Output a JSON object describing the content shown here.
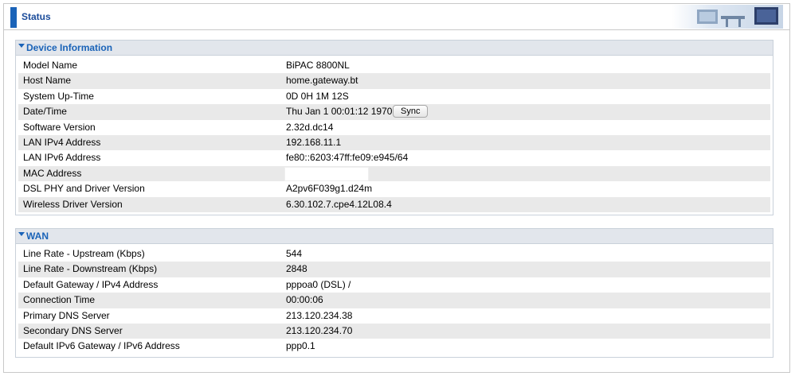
{
  "status": {
    "title": "Status"
  },
  "device": {
    "title": "Device Information",
    "rows": [
      {
        "key": "Model Name",
        "value": "BiPAC 8800NL"
      },
      {
        "key": "Host Name",
        "value": "home.gateway.bt"
      },
      {
        "key": "System Up-Time",
        "value": "0D 0H 1M 12S"
      },
      {
        "key": "Date/Time",
        "value": "Thu Jan 1 00:01:12 1970"
      },
      {
        "key": "Software Version",
        "value": "2.32d.dc14"
      },
      {
        "key": "LAN IPv4 Address",
        "value": "192.168.11.1"
      },
      {
        "key": "LAN IPv6 Address",
        "value": "fe80::6203:47ff:fe09:e945/64"
      },
      {
        "key": "MAC Address",
        "value": ""
      },
      {
        "key": "DSL PHY and Driver Version",
        "value": "A2pv6F039g1.d24m"
      },
      {
        "key": "Wireless Driver Version",
        "value": "6.30.102.7.cpe4.12L08.4"
      }
    ],
    "sync_label": "Sync"
  },
  "wan": {
    "title": "WAN",
    "rows": [
      {
        "key": "Line Rate - Upstream (Kbps)",
        "value": "544"
      },
      {
        "key": "Line Rate - Downstream (Kbps)",
        "value": "2848"
      },
      {
        "key": "Default Gateway / IPv4 Address",
        "value": "pppoa0 (DSL) /"
      },
      {
        "key": "Connection Time",
        "value": "00:00:06"
      },
      {
        "key": "Primary DNS Server",
        "value": "213.120.234.38"
      },
      {
        "key": "Secondary DNS Server",
        "value": "213.120.234.70"
      },
      {
        "key": "Default IPv6 Gateway / IPv6 Address",
        "value": "ppp0.1"
      }
    ]
  },
  "colors": {
    "accent": "#1a63b8",
    "header_bg": "#e2e6ec",
    "row_shade": "#e9e9e9"
  }
}
